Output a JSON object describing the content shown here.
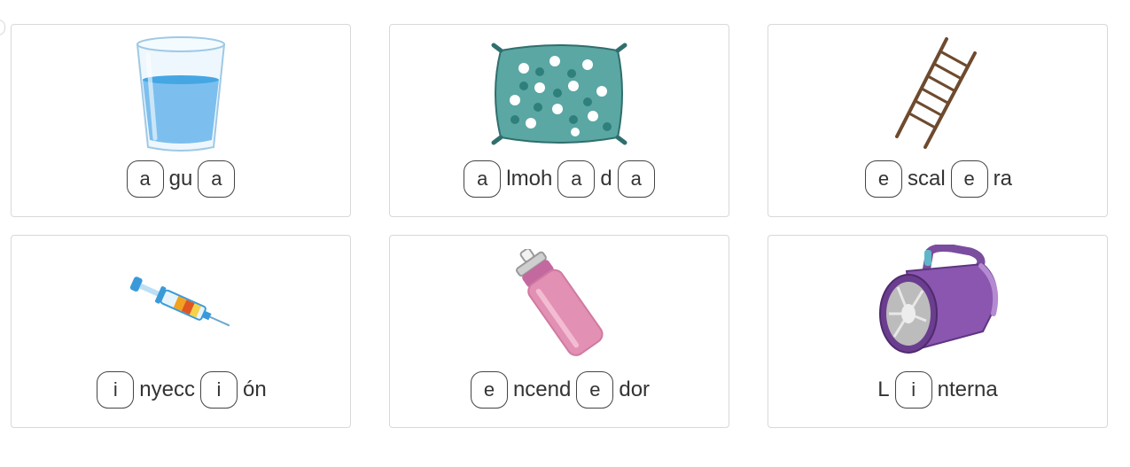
{
  "cards": [
    {
      "icon": "water-glass-icon",
      "parts": [
        {
          "type": "slot",
          "text": "a"
        },
        {
          "type": "text",
          "text": "gu"
        },
        {
          "type": "slot",
          "text": "a"
        }
      ]
    },
    {
      "icon": "pillow-icon",
      "parts": [
        {
          "type": "slot",
          "text": "a"
        },
        {
          "type": "text",
          "text": "lmoh"
        },
        {
          "type": "slot",
          "text": "a"
        },
        {
          "type": "text",
          "text": "d"
        },
        {
          "type": "slot",
          "text": "a"
        }
      ]
    },
    {
      "icon": "ladder-icon",
      "parts": [
        {
          "type": "slot",
          "text": "e"
        },
        {
          "type": "text",
          "text": "scal"
        },
        {
          "type": "slot",
          "text": "e"
        },
        {
          "type": "text",
          "text": "ra"
        }
      ]
    },
    {
      "icon": "syringe-icon",
      "parts": [
        {
          "type": "slot",
          "text": "i"
        },
        {
          "type": "text",
          "text": "nyecc"
        },
        {
          "type": "slot",
          "text": "i"
        },
        {
          "type": "text",
          "text": "ón"
        }
      ]
    },
    {
      "icon": "lighter-icon",
      "parts": [
        {
          "type": "slot",
          "text": "e"
        },
        {
          "type": "text",
          "text": "ncend"
        },
        {
          "type": "slot",
          "text": "e"
        },
        {
          "type": "text",
          "text": "dor"
        }
      ]
    },
    {
      "icon": "flashlight-icon",
      "parts": [
        {
          "type": "text",
          "text": "L"
        },
        {
          "type": "slot",
          "text": "i"
        },
        {
          "type": "text",
          "text": "nterna"
        }
      ]
    }
  ]
}
